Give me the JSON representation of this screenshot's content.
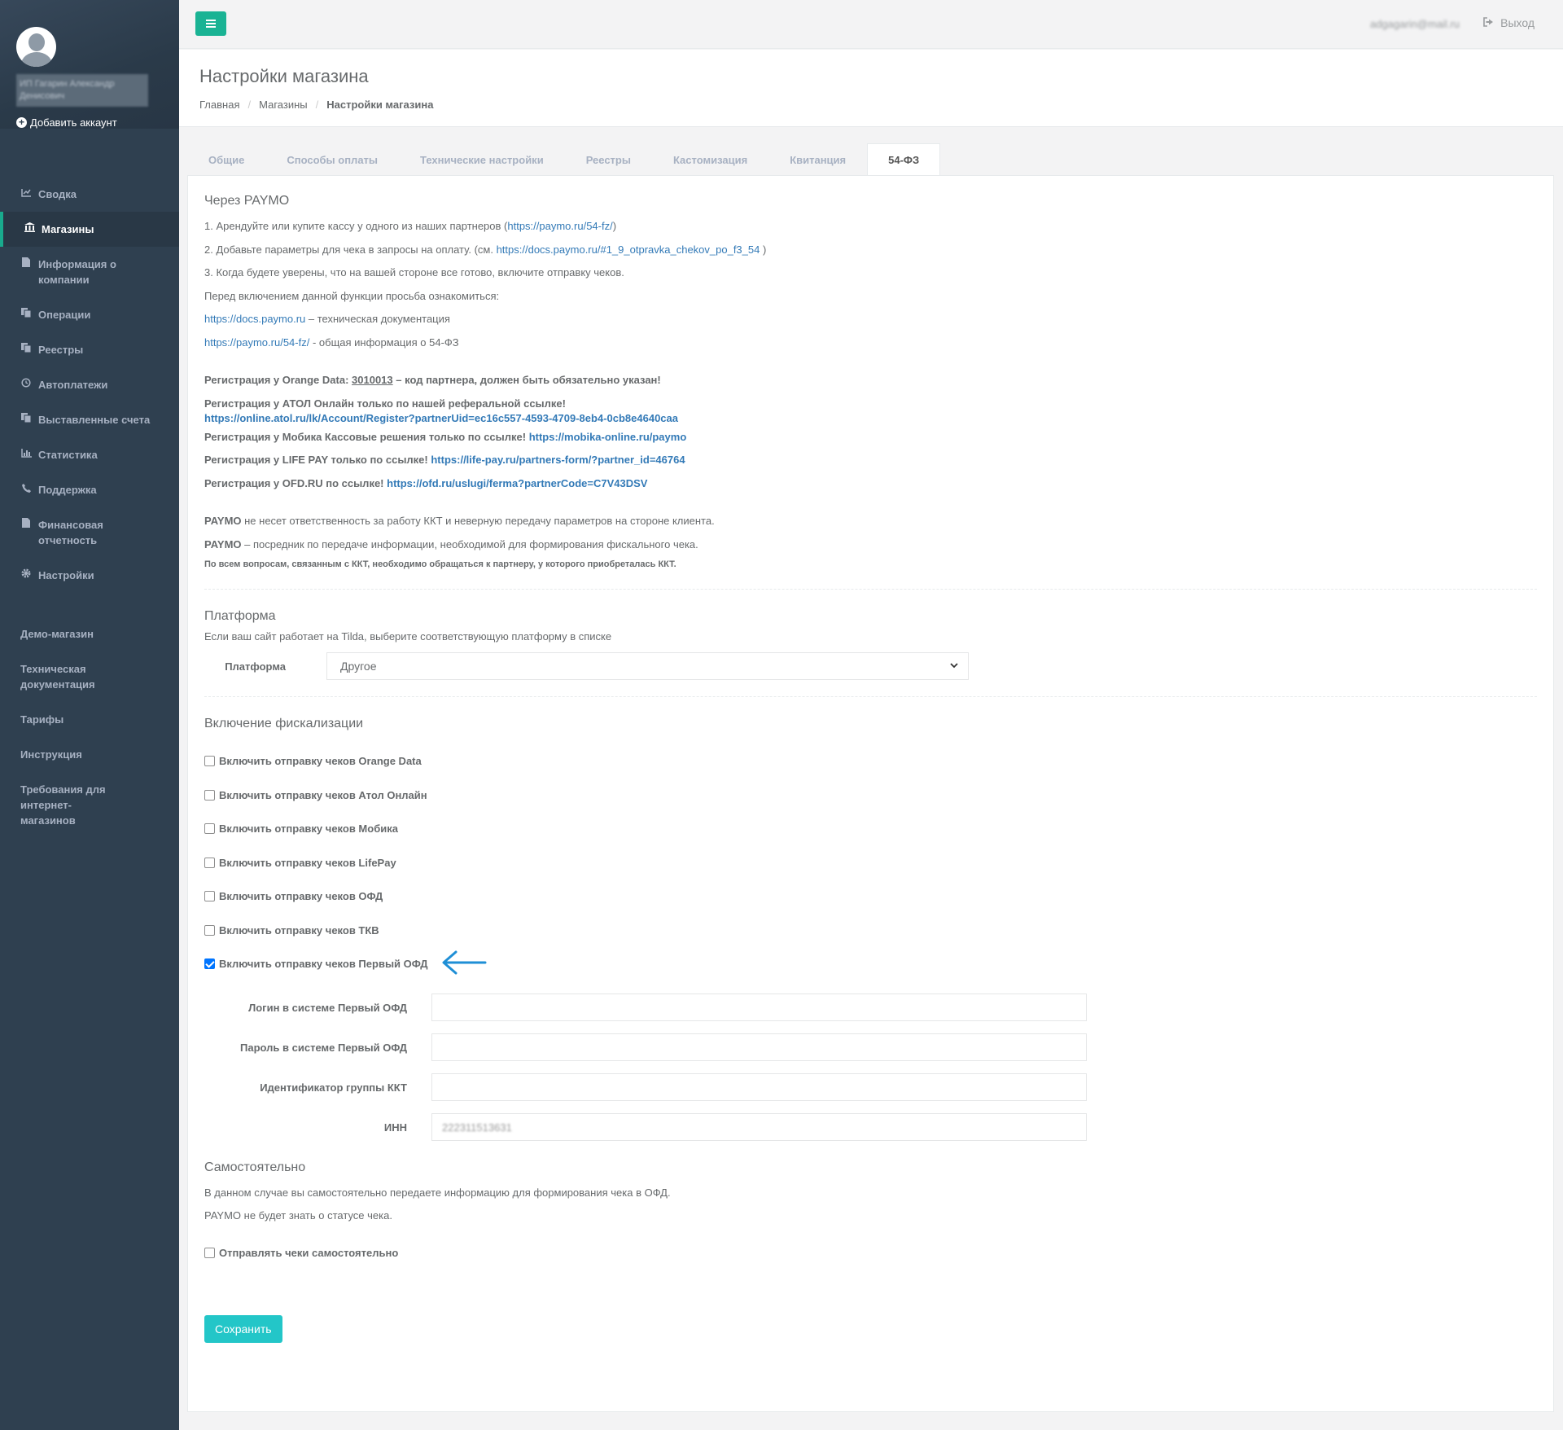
{
  "sidebar": {
    "user_name": "ИП Гагарин Александр Денисович",
    "add_account": "Добавить аккаунт",
    "items": [
      {
        "label": "Сводка",
        "icon": "chart-line-icon"
      },
      {
        "label": "Магазины",
        "icon": "bank-icon"
      },
      {
        "label": "Информация о компании",
        "icon": "file-icon"
      },
      {
        "label": "Операции",
        "icon": "copy-icon"
      },
      {
        "label": "Реестры",
        "icon": "copy-icon"
      },
      {
        "label": "Автоплатежи",
        "icon": "history-icon"
      },
      {
        "label": "Выставленные счета",
        "icon": "copy-icon"
      },
      {
        "label": "Статистика",
        "icon": "bar-chart-icon"
      },
      {
        "label": "Поддержка",
        "icon": "phone-icon"
      },
      {
        "label": "Финансовая отчетность",
        "icon": "file-icon"
      },
      {
        "label": "Настройки",
        "icon": "gear-icon"
      }
    ],
    "links": [
      "Демо-магазин",
      "Техническая документация",
      "Тарифы",
      "Инструкция",
      "Требования для интернет-магазинов"
    ]
  },
  "topbar": {
    "email": "adgagarin@mail.ru",
    "logout": "Выход"
  },
  "header": {
    "title": "Настройки магазина",
    "breadcrumb": [
      "Главная",
      "Магазины",
      "Настройки магазина"
    ]
  },
  "tabs": [
    "Общие",
    "Способы оплаты",
    "Технические настройки",
    "Реестры",
    "Кастомизация",
    "Квитанция",
    "54-ФЗ"
  ],
  "paymo": {
    "heading": "Через PAYMO",
    "step1_pre": "1. Арендуйте или купите кассу у одного из наших партнеров (",
    "step1_link": "https://paymo.ru/54-fz/",
    "step1_post": ")",
    "step2_pre": "2. Добавьте параметры для чека в запросы на оплату. (см. ",
    "step2_link": "https://docs.paymo.ru/#1_9_otpravka_chekov_po_f3_54",
    "step2_post": " )",
    "step3": "3. Когда будете уверены, что на вашей стороне все готово, включите отправку чеков.",
    "before_text": "Перед включением данной функции просьба ознакомиться:",
    "doc_link": "https://docs.paymo.ru",
    "doc_text": " – техническая документация",
    "info_link": "https://paymo.ru/54-fz/",
    "info_text": " - общая информация о 54-ФЗ",
    "orange_pre": "Регистрация у Orange Data: ",
    "orange_code": "3010013",
    "orange_post": " – код партнера, должен быть обязательно указан!",
    "atol_text": "Регистрация у АТОЛ Онлайн только по нашей реферальной ссылке!",
    "atol_link": "https://online.atol.ru/lk/Account/Register?partnerUid=ec16c557-4593-4709-8eb4-0cb8e4640caa",
    "mobika_text": "Регистрация у Мобика Кассовые решения только по ссылке! ",
    "mobika_link": "https://mobika-online.ru/paymo",
    "lifepay_text": "Регистрация у LIFE PAY только по ссылке! ",
    "lifepay_link": "https://life-pay.ru/partners-form/?partner_id=46764",
    "ofd_text": "Регистрация у OFD.RU по ссылке! ",
    "ofd_link": "https://ofd.ru/uslugi/ferma?partnerCode=C7V43DSV",
    "disclaimer1_brand": "PAYMO",
    "disclaimer1": " не несет ответственность за работу ККТ и неверную передачу параметров на стороне клиента.",
    "disclaimer2_brand": "PAYMO",
    "disclaimer2": " – посредник по передаче информации, необходимой для формирования фискального чека.",
    "disclaimer3": "По всем вопросам, связанным с ККТ, необходимо обращаться к партнеру, у которого приобреталась ККТ."
  },
  "platform": {
    "heading": "Платформа",
    "description": "Если ваш сайт работает на Tilda, выберите соответствующую платформу в списке",
    "label": "Платформа",
    "selected": "Другое"
  },
  "fiscal": {
    "heading": "Включение фискализации",
    "options": [
      {
        "label": "Включить отправку чеков Orange Data",
        "checked": false
      },
      {
        "label": "Включить отправку чеков Атол Онлайн",
        "checked": false
      },
      {
        "label": "Включить отправку чеков Мобика",
        "checked": false
      },
      {
        "label": "Включить отправку чеков LifePay",
        "checked": false
      },
      {
        "label": "Включить отправку чеков ОФД",
        "checked": false
      },
      {
        "label": "Включить отправку чеков ТКВ",
        "checked": false
      },
      {
        "label": "Включить отправку чеков Первый ОФД",
        "checked": true
      }
    ],
    "fields": [
      {
        "label": "Логин в системе Первый ОФД",
        "value": ""
      },
      {
        "label": "Пароль в системе Первый ОФД",
        "value": ""
      },
      {
        "label": "Идентификатор группы ККТ",
        "value": ""
      },
      {
        "label": "ИНН",
        "value": "222311513631"
      }
    ],
    "arrow_color": "#1f8fd6"
  },
  "self": {
    "heading": "Самостоятельно",
    "line1": "В данном случае вы самостоятельно передаете информацию для формирования чека в ОФД.",
    "line2": "PAYMO не будет знать о статусе чека.",
    "checkbox_label": "Отправлять чеки самостоятельно"
  },
  "save_label": "Сохранить",
  "colors": {
    "sidebar": "#2f4050",
    "accent": "#1ab394",
    "save_button": "#23c6c8",
    "link": "#337ab7"
  }
}
